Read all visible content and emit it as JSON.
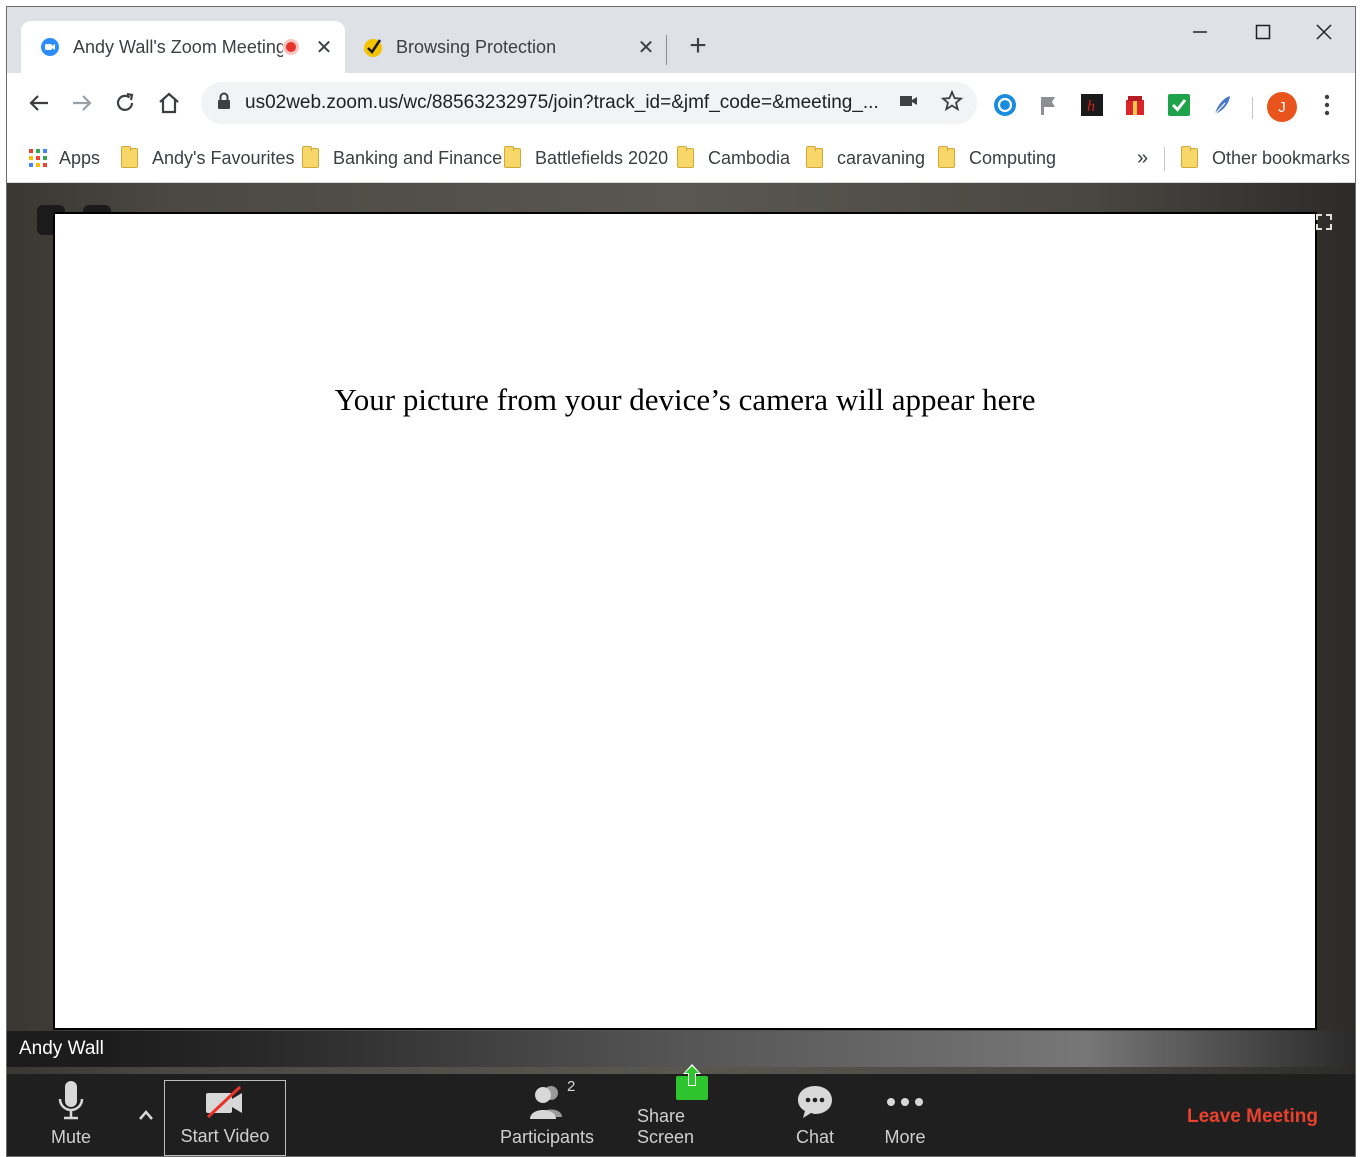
{
  "tabs": [
    {
      "title": "Andy Wall's Zoom Meeting",
      "active": true
    },
    {
      "title": "Browsing Protection",
      "active": false
    }
  ],
  "address_bar": {
    "url": "us02web.zoom.us/wc/88563232975/join?track_id=&jmf_code=&meeting_..."
  },
  "profile": {
    "initial": "J"
  },
  "bookmarks": {
    "apps_label": "Apps",
    "items": [
      "Andy's Favourites",
      "Banking and Finance",
      "Battlefields 2020",
      "Cambodia",
      "caravaning",
      "Computing"
    ],
    "overflow": "»",
    "other": "Other bookmarks"
  },
  "meeting": {
    "preview_message": "Your picture from your device’s camera will appear here",
    "participant_name": "Andy Wall"
  },
  "controls": {
    "mute": "Mute",
    "start_video": "Start Video",
    "participants": "Participants",
    "participants_count": "2",
    "share_screen": "Share Screen",
    "chat": "Chat",
    "more": "More",
    "leave": "Leave Meeting"
  },
  "colors": {
    "leave": "#e8412e",
    "share_green": "#2ec42e",
    "rec_red": "#e8332a",
    "avatar": "#e8541c"
  }
}
